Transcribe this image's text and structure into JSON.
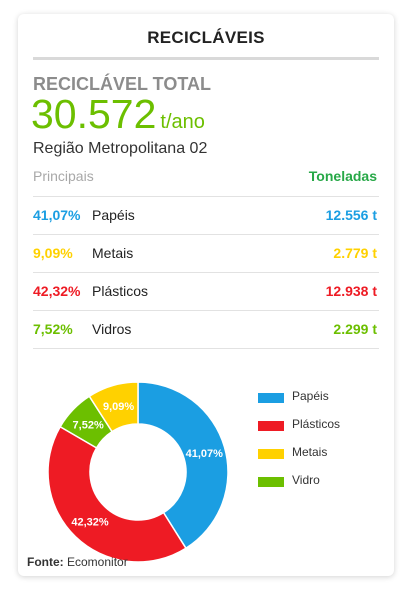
{
  "card": {
    "title": "RECICLÁVEIS",
    "total_label": "RECICLÁVEL TOTAL",
    "total_value": "30.572",
    "total_unit": "t/ano",
    "region": "Região Metropolitana 02",
    "header_left": "Principais",
    "header_right": "Toneladas",
    "source_label": "Fonte:",
    "source_value": "Ecomonitor"
  },
  "table": [
    {
      "percent": "41,07%",
      "name": "Papéis",
      "tons": "12.556 t",
      "color": "#1b9ee2"
    },
    {
      "percent": "9,09%",
      "name": "Metais",
      "tons": "2.779 t",
      "color": "#ffd100"
    },
    {
      "percent": "42,32%",
      "name": "Plásticos",
      "tons": "12.938 t",
      "color": "#ee1b24"
    },
    {
      "percent": "7,52%",
      "name": "Vidros",
      "tons": "2.299 t",
      "color": "#6cbf00"
    }
  ],
  "colors": {
    "accent_green": "#6cbf00",
    "header_green": "#27a847",
    "papeis": "#1b9ee2",
    "plasticos": "#ee1b24",
    "metais": "#ffd100",
    "vidro": "#6cbf00"
  },
  "chart_data": {
    "type": "pie",
    "donut": true,
    "categories": [
      "Papéis",
      "Plásticos",
      "Vidro",
      "Metais"
    ],
    "values": [
      41.07,
      42.32,
      7.52,
      9.09
    ],
    "labels": [
      "41,07%",
      "42,32%",
      "7,52%",
      "9,09%"
    ],
    "colors": [
      "#1b9ee2",
      "#ee1b24",
      "#6cbf00",
      "#ffd100"
    ],
    "legend": {
      "position": "right",
      "entries": [
        "Papéis",
        "Plásticos",
        "Metais",
        "Vidro"
      ],
      "colors": [
        "#1b9ee2",
        "#ee1b24",
        "#ffd100",
        "#6cbf00"
      ]
    }
  }
}
